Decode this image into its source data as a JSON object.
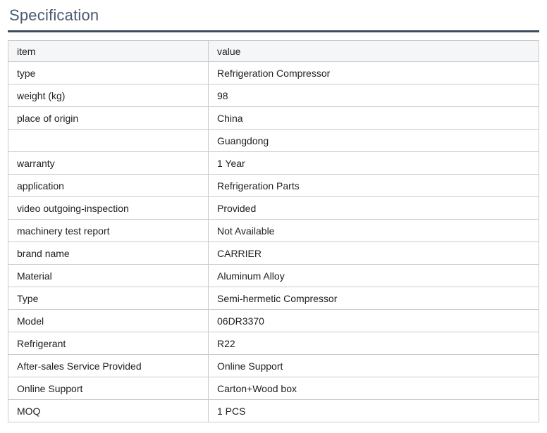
{
  "page_title": "Specification",
  "colors": {
    "title_text": "#4a5a6e",
    "title_rule": "#3d4e5f",
    "table_border": "#cbcbcb",
    "header_background": "#f5f6f8",
    "cell_text": "#212121",
    "page_background": "#ffffff"
  },
  "table": {
    "columns": [
      "item",
      "value"
    ],
    "rows": [
      {
        "item": "type",
        "value": "Refrigeration Compressor"
      },
      {
        "item": "weight (kg)",
        "value": "98"
      },
      {
        "item": "place of origin",
        "value": "China"
      },
      {
        "item": "",
        "value": "Guangdong"
      },
      {
        "item": "warranty",
        "value": "1 Year"
      },
      {
        "item": "application",
        "value": "Refrigeration Parts"
      },
      {
        "item": "video outgoing-inspection",
        "value": "Provided"
      },
      {
        "item": "machinery test report",
        "value": "Not Available"
      },
      {
        "item": "brand name",
        "value": "CARRIER"
      },
      {
        "item": "Material",
        "value": "Aluminum Alloy"
      },
      {
        "item": "Type",
        "value": "Semi-hermetic Compressor"
      },
      {
        "item": "Model",
        "value": "06DR3370"
      },
      {
        "item": "Refrigerant",
        "value": "R22"
      },
      {
        "item": "After-sales Service Provided",
        "value": "Online Support"
      },
      {
        "item": "Online Support",
        "value": "Carton+Wood box"
      },
      {
        "item": "MOQ",
        "value": "1 PCS"
      }
    ]
  }
}
